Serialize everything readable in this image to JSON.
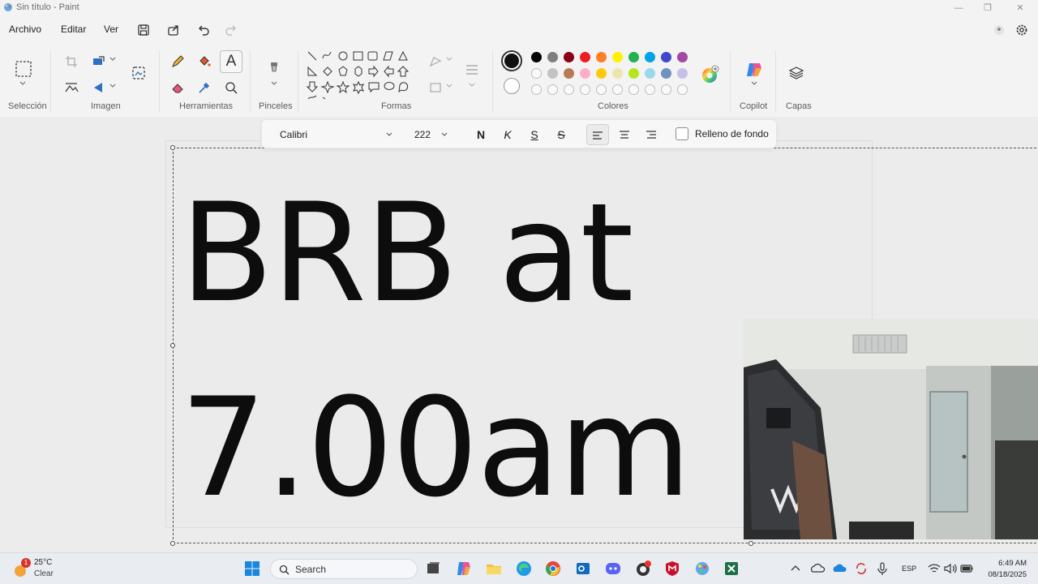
{
  "window": {
    "title": "Sin título - Paint",
    "minimize": "—",
    "maximize": "❐",
    "close": "✕"
  },
  "menu": {
    "file": "Archivo",
    "edit": "Editar",
    "view": "Ver"
  },
  "ribbon": {
    "groups": {
      "selection": "Selección",
      "image": "Imagen",
      "tools": "Herramientas",
      "brushes": "Pinceles",
      "shapes": "Formas",
      "colors": "Colores",
      "copilot": "Copilot",
      "layers": "Capas"
    },
    "text_tool_glyph": "A",
    "colors": {
      "primary": "#111111",
      "secondary": "#ffffff",
      "row1": [
        "#000000",
        "#7f7f7f",
        "#880015",
        "#ed1c24",
        "#ff7f27",
        "#fff200",
        "#22b14c",
        "#00a2e8",
        "#3f48cc",
        "#a349a4"
      ],
      "row2": [
        "#ffffff",
        "#c3c3c3",
        "#b97a57",
        "#ffaec9",
        "#ffc90e",
        "#efe4b0",
        "#b5e61d",
        "#99d9ea",
        "#7092be",
        "#c8bfe7"
      ]
    }
  },
  "text_toolbar": {
    "font": "Calibri",
    "size": "222",
    "bold": "N",
    "italic": "K",
    "underline": "S",
    "strikethrough": "S",
    "background_fill": "Relleno de fondo"
  },
  "canvas": {
    "line1": "BRB at",
    "line2": "7.00am"
  },
  "taskbar": {
    "weather_temp": "25°C",
    "weather_desc": "Clear",
    "weather_badge": "1",
    "search_label": "Search",
    "language": "ESP",
    "time": "6:49 AM",
    "date": "08/18/2025"
  }
}
